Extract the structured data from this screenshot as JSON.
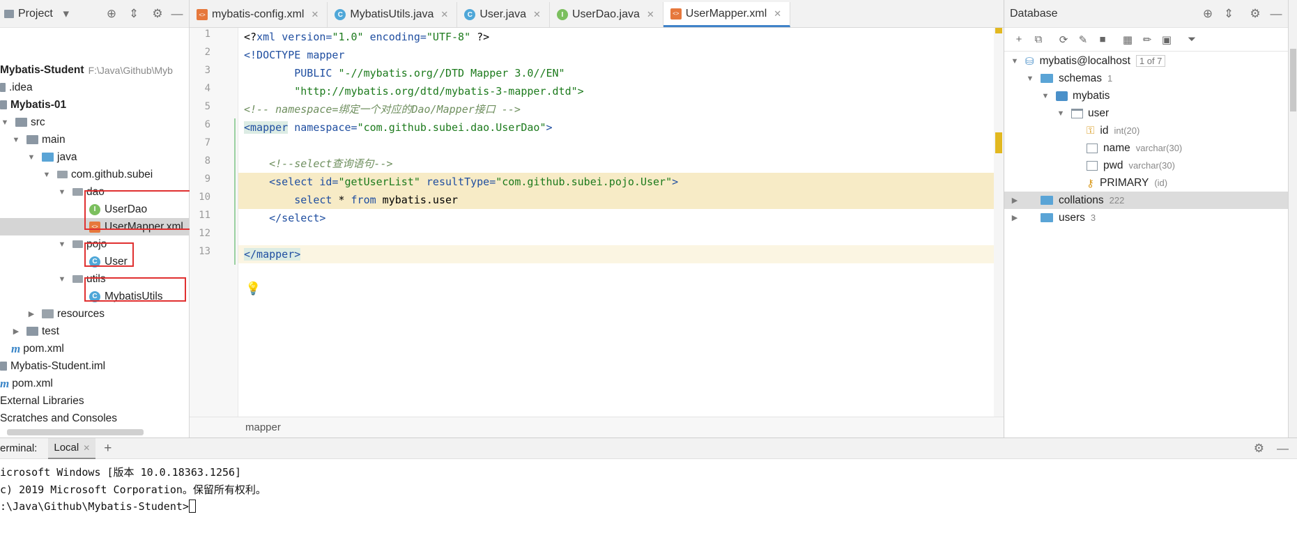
{
  "project": {
    "title": "Project",
    "header_icons": [
      "target-icon",
      "collapse-icon",
      "gear-icon",
      "minimize-icon"
    ],
    "root_name": "Mybatis-Student",
    "root_path": "F:\\Java\\Github\\Myb",
    "items": {
      "idea": ".idea",
      "module": "Mybatis-01",
      "src": "src",
      "main": "main",
      "java": "java",
      "package": "com.github.subei",
      "dao": "dao",
      "userdao": "UserDao",
      "usermapper": "UserMapper.xml",
      "pojo": "pojo",
      "user": "User",
      "utils": "utils",
      "mybatisutils": "MybatisUtils",
      "resources": "resources",
      "test": "test",
      "module_pom": "pom.xml",
      "iml": "Mybatis-Student.iml",
      "root_pom": "pom.xml",
      "external_libs": "External Libraries",
      "scratches": "Scratches and Consoles"
    }
  },
  "editor": {
    "tabs": [
      {
        "label": "mybatis-config.xml",
        "icon": "xml"
      },
      {
        "label": "MybatisUtils.java",
        "icon": "class"
      },
      {
        "label": "User.java",
        "icon": "class"
      },
      {
        "label": "UserDao.java",
        "icon": "interface"
      },
      {
        "label": "UserMapper.xml",
        "icon": "xml",
        "active": true
      }
    ],
    "line_numbers": [
      "1",
      "2",
      "3",
      "4",
      "5",
      "6",
      "7",
      "8",
      "9",
      "10",
      "11",
      "12",
      "13"
    ],
    "code": {
      "l1_a": "<?",
      "l1_b": "xml ",
      "l1_c": "version=",
      "l1_d": "\"1.0\"",
      "l1_e": " encoding=",
      "l1_f": "\"UTF-8\"",
      "l1_g": " ?>",
      "l2_a": "<!DOCTYPE ",
      "l2_b": "mapper",
      "l3_a": "        PUBLIC ",
      "l3_b": "\"-//mybatis.org//DTD Mapper 3.0//EN\"",
      "l4": "        \"http://mybatis.org/dtd/mybatis-3-mapper.dtd\">",
      "l5": "<!-- namespace=绑定一个对应的Dao/Mapper接口 -->",
      "l6_a": "<mapper",
      "l6_b": " namespace=",
      "l6_c": "\"com.github.subei.dao.UserDao\"",
      "l6_d": ">",
      "l8": "    <!--select查询语句-->",
      "l9_a": "    <select",
      "l9_b": " id=",
      "l9_c": "\"getUserList\"",
      "l9_d": " resultType=",
      "l9_e": "\"com.github.subei.pojo.User\"",
      "l9_f": ">",
      "l10_a": "        select",
      "l10_b": " * ",
      "l10_c": "from",
      "l10_d": " mybatis.user",
      "l11": "    </select>",
      "l13": "</mapper>"
    },
    "breadcrumb": "mapper"
  },
  "database": {
    "title": "Database",
    "toolbar_icons": [
      "add-icon",
      "copy-icon",
      "refresh-icon",
      "edit-properties-icon",
      "stop-icon",
      "table-icon",
      "pencil-icon",
      "sql-console-icon",
      "filter-icon"
    ],
    "datasource": "mybatis@localhost",
    "datasource_badge": "1 of 7",
    "schemas_label": "schemas",
    "schemas_count": "1",
    "schema": "mybatis",
    "table": "user",
    "columns": [
      {
        "name": "id",
        "type": "int(20)"
      },
      {
        "name": "name",
        "type": "varchar(30)"
      },
      {
        "name": "pwd",
        "type": "varchar(30)"
      }
    ],
    "key_name": "PRIMARY",
    "key_cols": "(id)",
    "collations": "collations",
    "collations_count": "222",
    "users": "users",
    "users_count": "3"
  },
  "terminal": {
    "label": "erminal:",
    "tab": "Local",
    "lines": [
      "icrosoft Windows [版本 10.0.18363.1256]",
      "c) 2019 Microsoft Corporation。保留所有权利。",
      ":\\Java\\Github\\Mybatis-Student>"
    ]
  },
  "colors": {
    "accent": "#4083c9",
    "highlight_line": "#f7ebc6",
    "red_box": "#e03030"
  }
}
